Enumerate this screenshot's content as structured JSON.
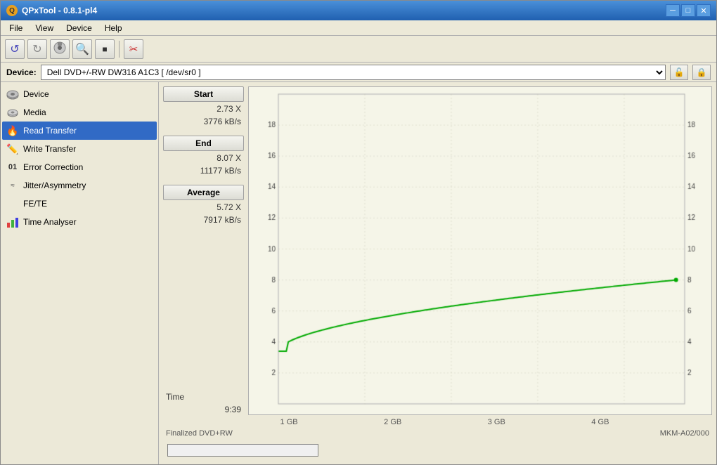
{
  "window": {
    "title": "QPxTool - 0.8.1-pl4",
    "app_icon_label": "Q"
  },
  "title_controls": {
    "minimize": "─",
    "maximize": "□",
    "close": "✕"
  },
  "menu": {
    "items": [
      "File",
      "View",
      "Device",
      "Help"
    ]
  },
  "toolbar": {
    "buttons": [
      {
        "name": "refresh-icon",
        "symbol": "↺"
      },
      {
        "name": "refresh2-icon",
        "symbol": "↻"
      },
      {
        "name": "open-icon",
        "symbol": "📁"
      },
      {
        "name": "zoom-icon",
        "symbol": "🔍"
      },
      {
        "name": "stop-icon",
        "symbol": "■"
      },
      {
        "name": "settings-icon",
        "symbol": "⚙"
      }
    ]
  },
  "device_bar": {
    "label": "Device:",
    "value": "Dell    DVD+/-RW DW316    A1C3  [ /dev/sr0 ]",
    "lock_icon": "🔒",
    "eject_icon": "⏏"
  },
  "sidebar": {
    "items": [
      {
        "id": "device",
        "label": "Device",
        "icon": "💿",
        "active": false
      },
      {
        "id": "media",
        "label": "Media",
        "icon": "💽",
        "active": false
      },
      {
        "id": "read-transfer",
        "label": "Read Transfer",
        "icon": "🔥",
        "active": true
      },
      {
        "id": "write-transfer",
        "label": "Write Transfer",
        "icon": "✏️",
        "active": false
      },
      {
        "id": "error-correction",
        "label": "Error Correction",
        "icon": "01",
        "active": false
      },
      {
        "id": "jitter-asymmetry",
        "label": "Jitter/Asymmetry",
        "icon": "",
        "active": false
      },
      {
        "id": "fe-te",
        "label": "FE/TE",
        "icon": "",
        "active": false
      },
      {
        "id": "time-analyser",
        "label": "Time Analyser",
        "icon": "📊",
        "active": false
      }
    ]
  },
  "stats": {
    "start_label": "Start",
    "end_label": "End",
    "average_label": "Average",
    "start_speed": "2.73 X",
    "start_rate": "3776 kB/s",
    "end_speed": "8.07 X",
    "end_rate": "11177 kB/s",
    "avg_speed": "5.72 X",
    "avg_rate": "7917 kB/s",
    "time_label": "Time",
    "time_value": "9:39"
  },
  "chart": {
    "y_axis_left": [
      "18",
      "16",
      "14",
      "12",
      "10",
      "8",
      "6",
      "4",
      "2"
    ],
    "y_axis_right": [
      "18",
      "16",
      "14",
      "12",
      "10",
      "8",
      "6",
      "4",
      "2"
    ],
    "x_axis": [
      "1 GB",
      "2 GB",
      "3 GB",
      "4 GB"
    ],
    "footer_left": "Finalized DVD+RW",
    "footer_right": "MKM-A02/000",
    "accent_color": "#00aa00"
  }
}
